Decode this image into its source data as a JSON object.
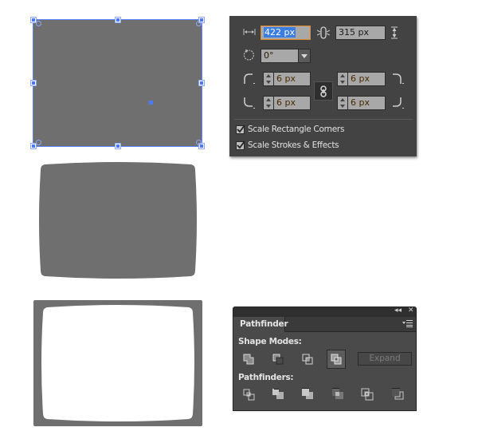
{
  "artboard": {
    "shapes": [
      {
        "name": "selected-rectangle",
        "fill": "#6f6f6f",
        "selection_color": "#4a78ff",
        "state": "selected"
      },
      {
        "name": "warped-rectangle",
        "fill": "#6f6f6f"
      },
      {
        "name": "frame-with-cutout",
        "fill": "#6f6f6f",
        "cutout_fill": "#ffffff"
      }
    ]
  },
  "transform_panel": {
    "width_label_icon": "width-icon",
    "width_value": "422 px",
    "constrain_icon": "constrain-proportions-icon",
    "height_value": "315 px",
    "height_label_icon": "height-icon",
    "rotate_icon": "rotate-icon",
    "rotation_value": "0°",
    "corners": {
      "top_left": "6 px",
      "top_right": "6 px",
      "bottom_left": "6 px",
      "bottom_right": "6 px"
    },
    "link_corners_icon": "link-icon",
    "checkboxes": [
      {
        "label": "Scale Rectangle Corners",
        "checked": true
      },
      {
        "label": "Scale Strokes & Effects",
        "checked": true
      }
    ]
  },
  "pathfinder_panel": {
    "collapse_icon": "collapse-icon",
    "close_icon": "close-icon",
    "tab_label": "Pathfinder",
    "menu_icon": "panel-menu-icon",
    "shape_modes_label": "Shape Modes:",
    "shape_modes": [
      {
        "name": "unite",
        "active": false
      },
      {
        "name": "minus-front",
        "active": false
      },
      {
        "name": "intersect",
        "active": false
      },
      {
        "name": "exclude",
        "active": true
      }
    ],
    "expand_label": "Expand",
    "pathfinders_label": "Pathfinders:",
    "pathfinders": [
      {
        "name": "divide"
      },
      {
        "name": "trim"
      },
      {
        "name": "merge"
      },
      {
        "name": "crop"
      },
      {
        "name": "outline"
      },
      {
        "name": "minus-back"
      }
    ]
  }
}
